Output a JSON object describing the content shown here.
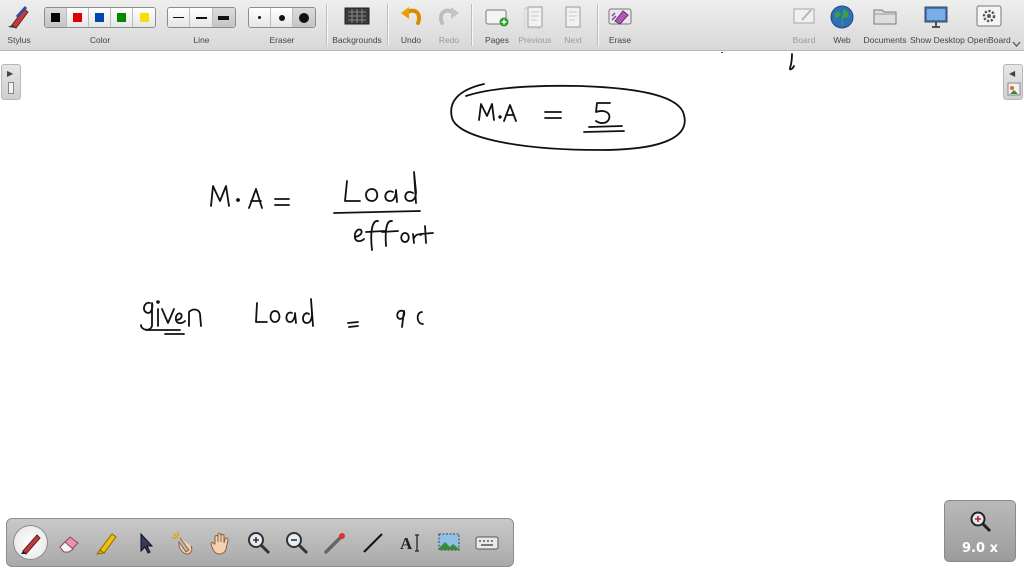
{
  "toolbar": {
    "stylus": "Stylus",
    "color": "Color",
    "line": "Line",
    "eraser": "Eraser",
    "backgrounds": "Backgrounds",
    "undo": "Undo",
    "redo": "Redo",
    "pages": "Pages",
    "previous": "Previous",
    "next": "Next",
    "erase": "Erase",
    "board": "Board",
    "web": "Web",
    "documents": "Documents",
    "show_desktop": "Show Desktop",
    "openboard": "OpenBoard"
  },
  "colors": [
    "#000000",
    "#e00000",
    "#0048b0",
    "#008a00",
    "#f5e000"
  ],
  "zoom": {
    "label": "9.0 x"
  },
  "palette_tools": [
    "pen-icon",
    "eraser-icon",
    "marker-icon",
    "selector-icon",
    "interactor-icon",
    "zoom-in-icon",
    "zoom-out-icon",
    "laser-pointer-icon",
    "line-icon",
    "text-icon",
    "capture-icon",
    "virtual-keyboard-icon"
  ]
}
